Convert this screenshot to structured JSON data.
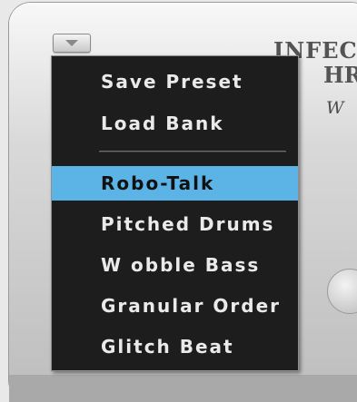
{
  "logo": {
    "line1": "INFEC",
    "line2": "HR",
    "script": "W"
  },
  "preset_button": {
    "icon": "chevron-down-icon"
  },
  "menu": {
    "top_items": [
      {
        "label": "Save Preset"
      },
      {
        "label": "Load Bank"
      }
    ],
    "presets": [
      {
        "label": "Robo-Talk",
        "selected": true
      },
      {
        "label": "Pitched Drums",
        "selected": false
      },
      {
        "label": "W obble Bass",
        "selected": false
      },
      {
        "label": "Granular Order",
        "selected": false
      },
      {
        "label": "Glitch Beat",
        "selected": false
      }
    ]
  },
  "colors": {
    "menu_background": "#1d1d1d",
    "menu_text": "#eaeaea",
    "selection": "#5cb4e6"
  }
}
